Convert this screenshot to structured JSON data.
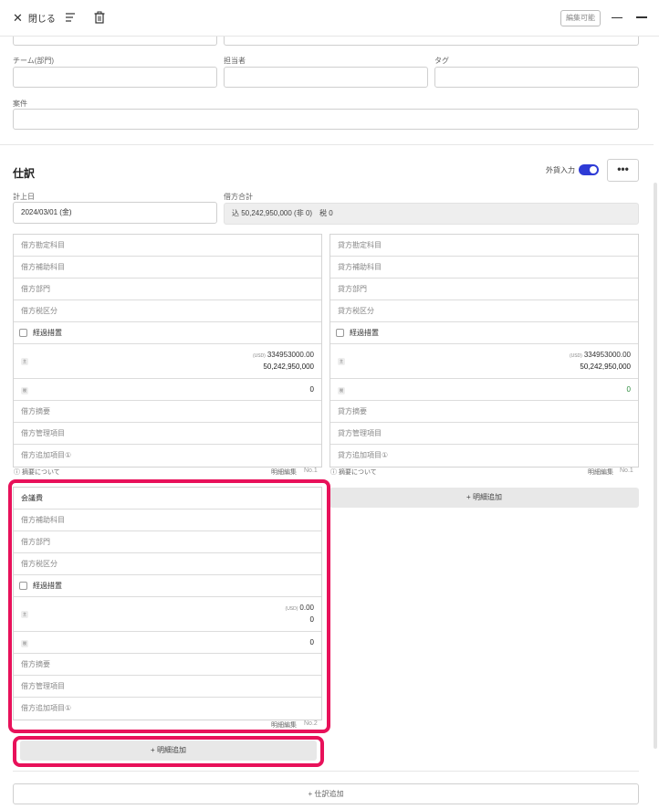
{
  "topbar": {
    "close_label": "閉じる",
    "editable_badge": "編集可能"
  },
  "form": {
    "team_label": "チーム(部門)",
    "owner_label": "担当者",
    "tag_label": "タグ",
    "project_label": "案件"
  },
  "journal": {
    "title": "仕訳",
    "fx_label": "外貨入力",
    "more_label": "•••",
    "date_label": "計上日",
    "date_value": "2024/03/01 (金)",
    "debit_total_label": "借方合計",
    "debit_total_value": "込 50,242,950,000 (非 0)　税 0"
  },
  "entries": [
    {
      "debit": {
        "rows": [
          "借方勘定科目",
          "借方補助科目",
          "借方部門",
          "借方税区分"
        ],
        "transitional": "経過措置",
        "tag_amount": "主",
        "usd_tag": "(USD)",
        "usd_value": "334953000.00",
        "jpy_value": "50,242,950,000",
        "tag_tax": "税",
        "tax_value": "0",
        "rows2": [
          "借方摘要",
          "借方管理項目",
          "借方追加項目①"
        ]
      },
      "credit": {
        "rows": [
          "貸方勘定科目",
          "貸方補助科目",
          "貸方部門",
          "貸方税区分"
        ],
        "transitional": "経過措置",
        "tag_amount": "主",
        "usd_tag": "(USD)",
        "usd_value": "334953000.00",
        "jpy_value": "50,242,950,000",
        "tag_tax": "税",
        "tax_value": "0",
        "rows2": [
          "貸方摘要",
          "貸方管理項目",
          "貸方追加項目①"
        ]
      },
      "about_summary": "ⓘ 摘要について",
      "detail_edit": "明細編集",
      "number": "No.1"
    },
    {
      "debit": {
        "rows": [
          "会議費",
          "借方補助科目",
          "借方部門",
          "借方税区分"
        ],
        "transitional": "経過措置",
        "tag_amount": "主",
        "usd_tag": "(USD)",
        "usd_value": "0.00",
        "jpy_value": "0",
        "tag_tax": "税",
        "tax_value": "0",
        "rows2": [
          "借方摘要",
          "借方管理項目",
          "借方追加項目①"
        ]
      },
      "detail_edit": "明細編集",
      "number": "No.2"
    }
  ],
  "add_detail_label": "+ 明細追加",
  "add_journal_label": "+ 仕訳追加",
  "colors": {
    "highlight": "#e8115a",
    "toggle": "#2e3bd6"
  }
}
